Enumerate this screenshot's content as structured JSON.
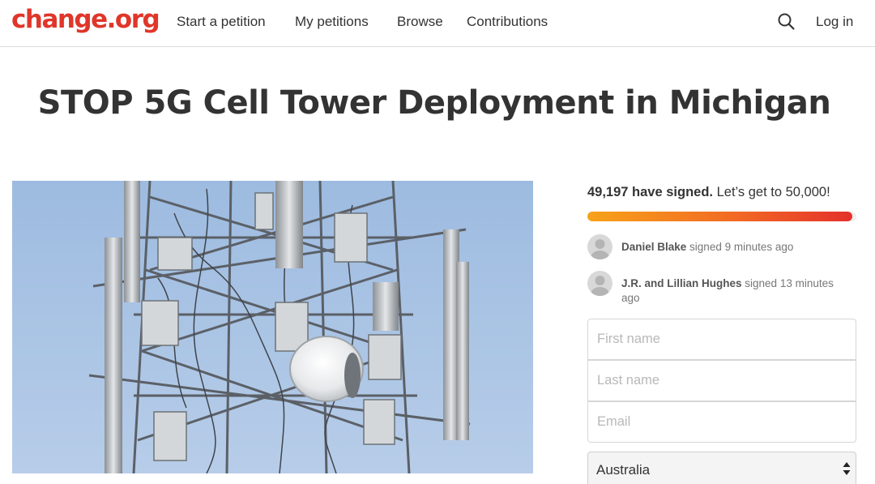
{
  "header": {
    "logo": "change.org",
    "nav": [
      "Start a petition",
      "My petitions",
      "Browse",
      "Contributions"
    ],
    "login": "Log in"
  },
  "petition": {
    "title": "STOP 5G Cell Tower Deployment in Michigan",
    "signed_count": "49,197 have signed.",
    "goal_text": " Let’s get to 50,000!",
    "progress_fraction": 0.984
  },
  "recent_signers": [
    {
      "name": "Daniel Blake",
      "action": " signed 9 minutes ago"
    },
    {
      "name": "J.R. and Lillian Hughes",
      "action": " signed 13 minutes ago"
    }
  ],
  "form": {
    "first_name_placeholder": "First name",
    "last_name_placeholder": "Last name",
    "email_placeholder": "Email",
    "country_value": "Australia"
  },
  "colors": {
    "brand": "#e0362a",
    "progress_start": "#f7a21a",
    "progress_end": "#e4312b"
  }
}
